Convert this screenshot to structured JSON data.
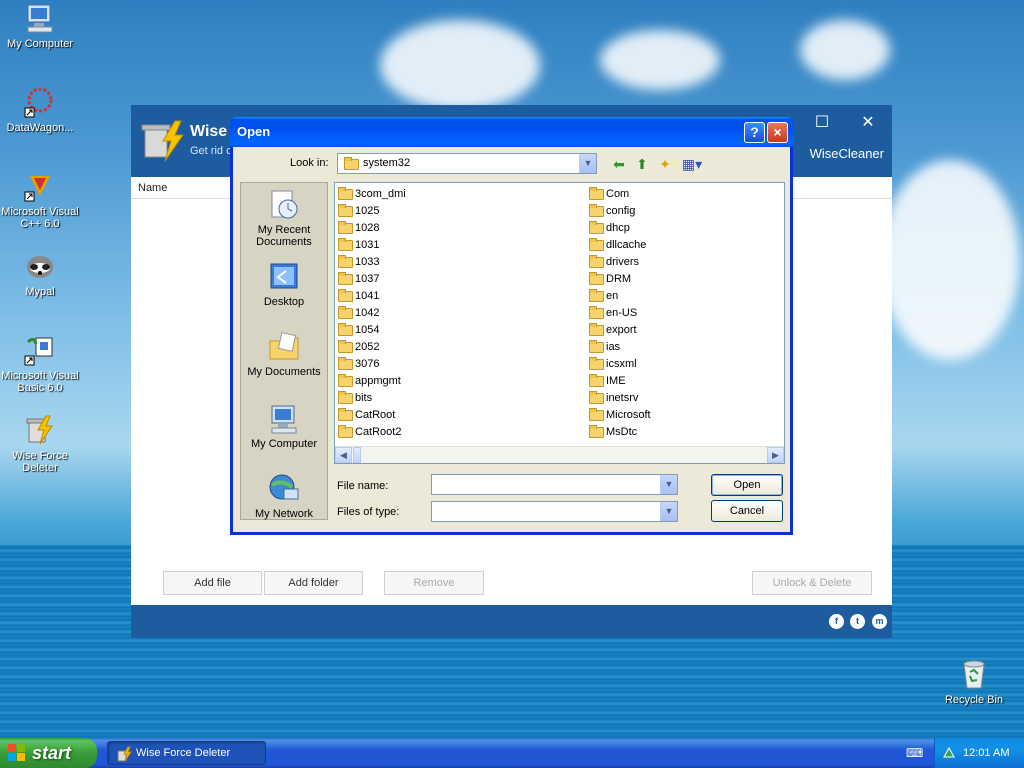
{
  "desktop": {
    "icons": [
      {
        "label": "My Computer"
      },
      {
        "label": "DataWagon..."
      },
      {
        "label": "Microsoft Visual C++ 6.0"
      },
      {
        "label": "Mypal"
      },
      {
        "label": "Microsoft Visual Basic 6.0"
      },
      {
        "label": "Wise Force Deleter"
      },
      {
        "label": "Recycle Bin"
      }
    ]
  },
  "app": {
    "title": "Wise",
    "subtitle": "Get rid c",
    "brand": "WiseCleaner",
    "column_name": "Name",
    "buttons": {
      "add_file": "Add file",
      "add_folder": "Add folder",
      "remove": "Remove",
      "unlock_delete": "Unlock & Delete"
    },
    "social": [
      "f",
      "t",
      "m"
    ]
  },
  "dialog": {
    "title": "Open",
    "help_button": "?",
    "close_button": "×",
    "look_in_label": "Look in:",
    "look_in_value": "system32",
    "places": [
      {
        "label": "My Recent Documents"
      },
      {
        "label": "Desktop"
      },
      {
        "label": "My Documents"
      },
      {
        "label": "My Computer"
      },
      {
        "label": "My Network"
      }
    ],
    "files_col1": [
      "3com_dmi",
      "1025",
      "1028",
      "1031",
      "1033",
      "1037",
      "1041",
      "1042",
      "1054",
      "2052",
      "3076",
      "appmgmt",
      "bits",
      "CatRoot",
      "CatRoot2"
    ],
    "files_col2": [
      "Com",
      "config",
      "dhcp",
      "dllcache",
      "drivers",
      "DRM",
      "en",
      "en-US",
      "export",
      "ias",
      "icsxml",
      "IME",
      "inetsrv",
      "Microsoft",
      "MsDtc"
    ],
    "file_name_label": "File name:",
    "file_name_value": "",
    "files_of_type_label": "Files of type:",
    "files_of_type_value": "",
    "open_button": "Open",
    "cancel_button": "Cancel"
  },
  "taskbar": {
    "start_label": "start",
    "task_label": "Wise Force Deleter",
    "clock": "12:01 AM"
  }
}
